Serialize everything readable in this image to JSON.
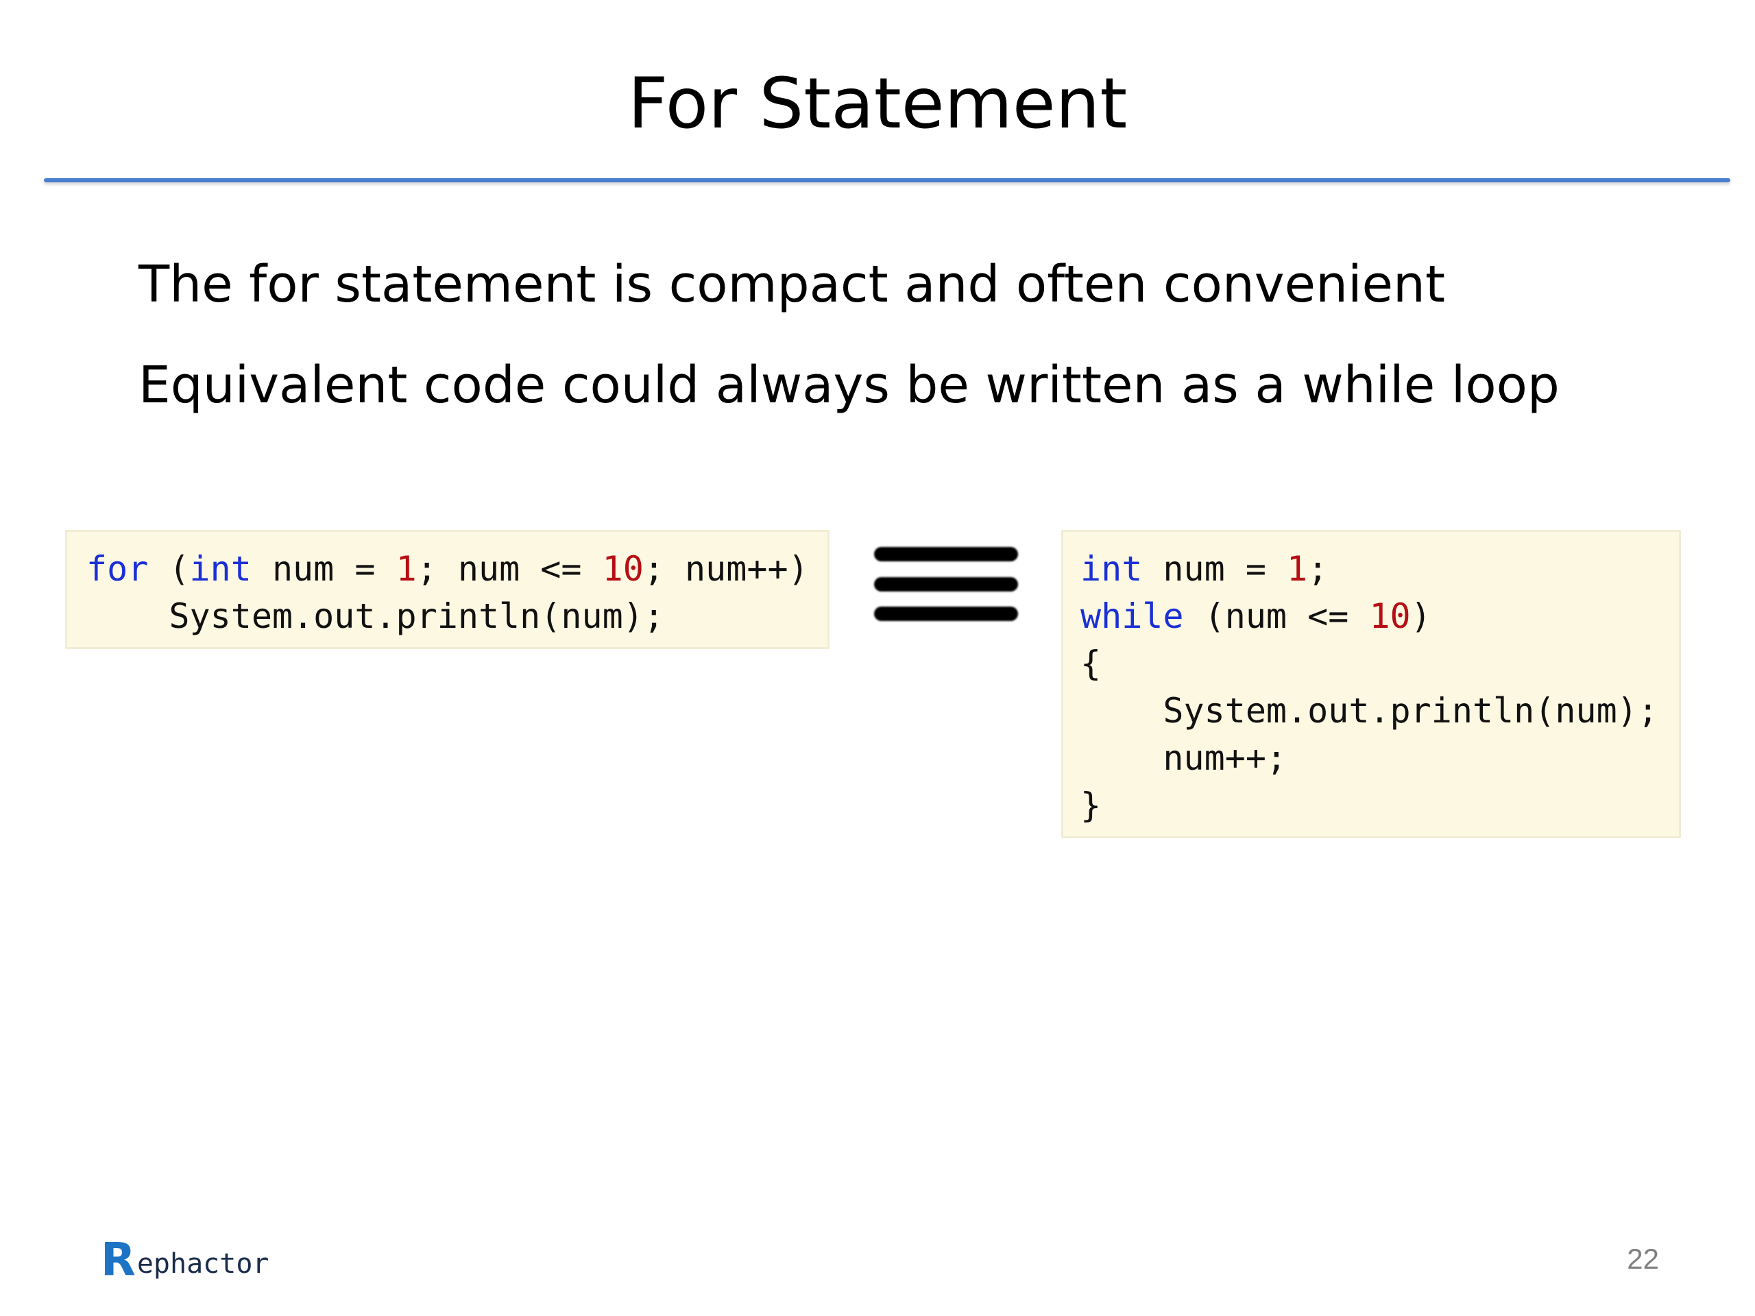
{
  "slide": {
    "title": "For Statement",
    "bullets": [
      "The for statement is compact and often convenient",
      "Equivalent code could always be written as a while loop"
    ],
    "page_number": "22"
  },
  "code_left": {
    "lines": [
      [
        {
          "t": "for",
          "c": "kw"
        },
        {
          "t": " ("
        },
        {
          "t": "int",
          "c": "kw"
        },
        {
          "t": " num = "
        },
        {
          "t": "1",
          "c": "num"
        },
        {
          "t": "; num <= "
        },
        {
          "t": "10",
          "c": "num"
        },
        {
          "t": "; num++)"
        }
      ],
      [
        {
          "t": "    System.out.println(num);"
        }
      ]
    ]
  },
  "code_right": {
    "lines": [
      [
        {
          "t": "int",
          "c": "kw"
        },
        {
          "t": " num = "
        },
        {
          "t": "1",
          "c": "num"
        },
        {
          "t": ";"
        }
      ],
      [
        {
          "t": "while",
          "c": "kw"
        },
        {
          "t": " (num <= "
        },
        {
          "t": "10",
          "c": "num"
        },
        {
          "t": ")"
        }
      ],
      [
        {
          "t": "{"
        }
      ],
      [
        {
          "t": "    System.out.println(num);"
        }
      ],
      [
        {
          "t": "    num++;"
        }
      ],
      [
        {
          "t": "}"
        }
      ]
    ]
  },
  "equivalence_icon": "identical-to-icon",
  "logo": {
    "initial": "R",
    "rest": "ephactor"
  },
  "colors": {
    "title_rule": "#4a7fd0",
    "code_background": "#fdf8e2",
    "keyword": "#1a2fd6",
    "number_literal": "#b50f14",
    "logo_initial": "#1d73c4",
    "page_number": "#7f7f7f"
  }
}
